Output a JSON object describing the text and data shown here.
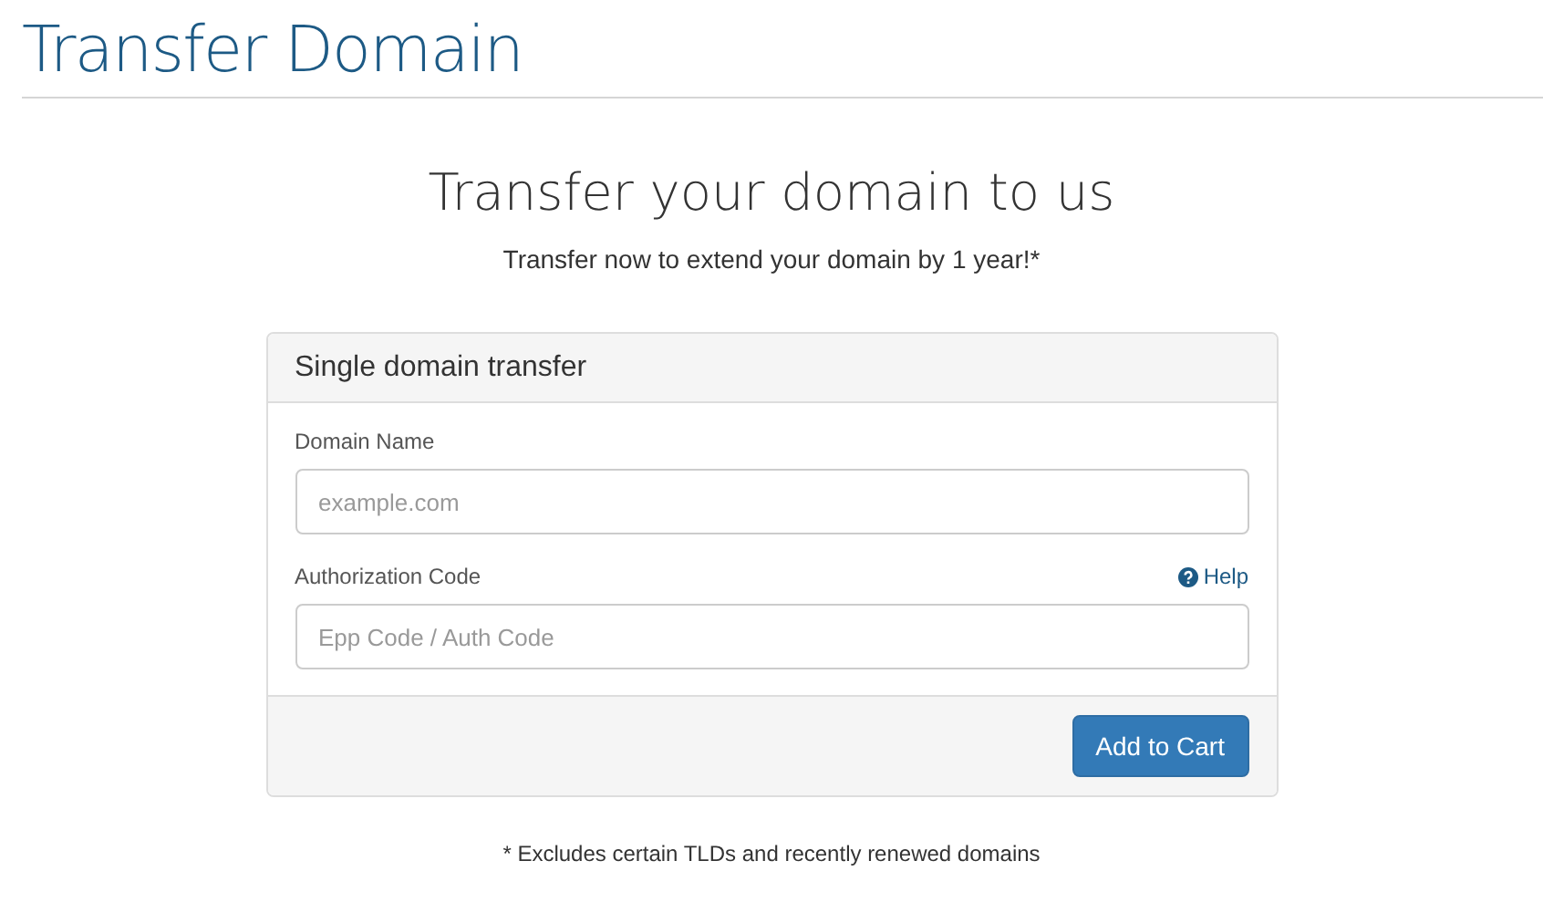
{
  "page_title": "Transfer Domain",
  "heading": "Transfer your domain to us",
  "subheading": "Transfer now to extend your domain by 1 year!*",
  "card": {
    "title": "Single domain transfer",
    "fields": [
      {
        "label": "Domain Name",
        "placeholder": "example.com"
      },
      {
        "label": "Authorization Code",
        "placeholder": "Epp Code / Auth Code",
        "help_link": "Help"
      }
    ],
    "button": "Add to Cart"
  },
  "footnote": "* Excludes certain TLDs and recently renewed domains"
}
